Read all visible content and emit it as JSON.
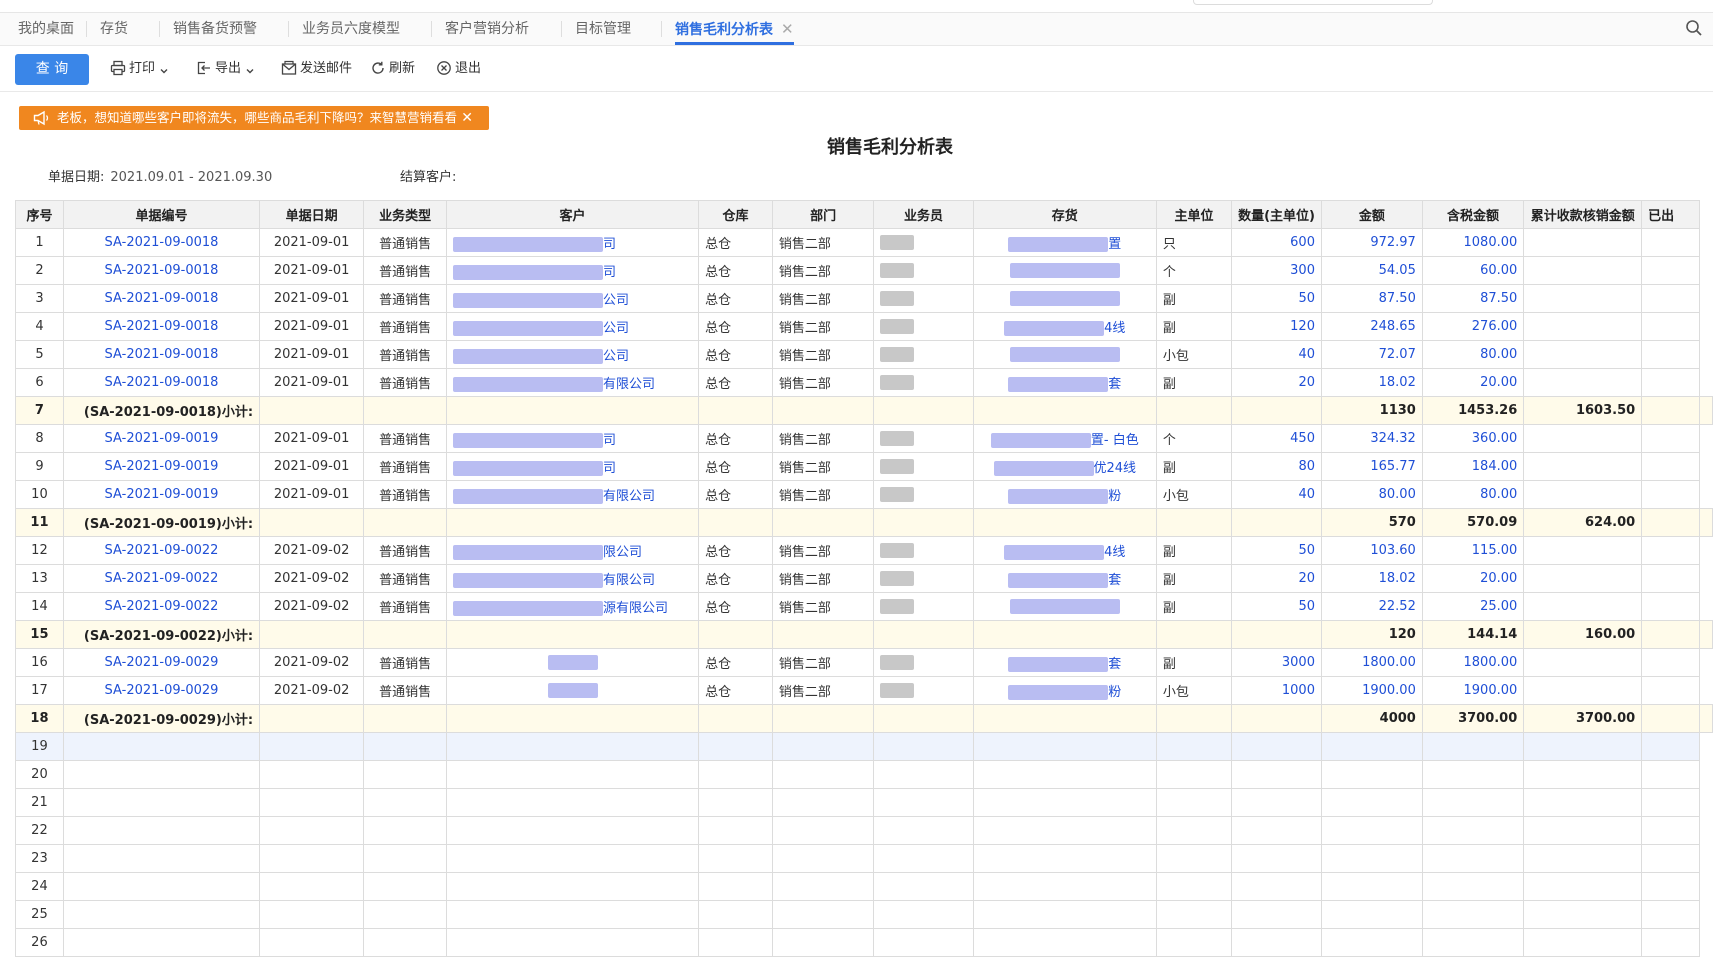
{
  "tabs": [
    {
      "label": "我的桌面",
      "active": false
    },
    {
      "label": "存货",
      "active": false
    },
    {
      "label": "销售备货预警",
      "active": false
    },
    {
      "label": "业务员六度模型",
      "active": false
    },
    {
      "label": "客户营销分析",
      "active": false
    },
    {
      "label": "目标管理",
      "active": false
    },
    {
      "label": "销售毛利分析表",
      "active": true
    }
  ],
  "toolbar": {
    "query": "查 询",
    "print": "打印",
    "export": "导出",
    "send_mail": "发送邮件",
    "refresh": "刷新",
    "exit": "退出"
  },
  "banner": {
    "text": "老板，想知道哪些客户即将流失，哪些商品毛利下降吗？来智慧营销看看"
  },
  "report": {
    "title": "销售毛利分析表",
    "date_label": "单据日期:",
    "date_value": "2021.09.01 - 2021.09.30",
    "customer_label": "结算客户:"
  },
  "columns": [
    "序号",
    "单据编号",
    "单据日期",
    "业务类型",
    "客户",
    "仓库",
    "部门",
    "业务员",
    "存货",
    "主单位",
    "数量(主单位)",
    "金额",
    "含税金额",
    "累计收款核销金额",
    "已出"
  ],
  "rows": [
    {
      "no": "1",
      "doc": "SA-2021-09-0018",
      "date": "2021-09-01",
      "type": "普通销售",
      "cust_tail": "司",
      "wh": "总仓",
      "dept": "销售二部",
      "inv_tail": "置",
      "unit": "只",
      "qty": "600",
      "amt": "972.97",
      "tax": "1080.00"
    },
    {
      "no": "2",
      "doc": "SA-2021-09-0018",
      "date": "2021-09-01",
      "type": "普通销售",
      "cust_tail": "司",
      "wh": "总仓",
      "dept": "销售二部",
      "inv_tail": "",
      "unit": "个",
      "qty": "300",
      "amt": "54.05",
      "tax": "60.00"
    },
    {
      "no": "3",
      "doc": "SA-2021-09-0018",
      "date": "2021-09-01",
      "type": "普通销售",
      "cust_tail": "公司",
      "wh": "总仓",
      "dept": "销售二部",
      "inv_tail": "",
      "unit": "副",
      "qty": "50",
      "amt": "87.50",
      "tax": "87.50"
    },
    {
      "no": "4",
      "doc": "SA-2021-09-0018",
      "date": "2021-09-01",
      "type": "普通销售",
      "cust_tail": "公司",
      "wh": "总仓",
      "dept": "销售二部",
      "inv_tail": "4线",
      "unit": "副",
      "qty": "120",
      "amt": "248.65",
      "tax": "276.00"
    },
    {
      "no": "5",
      "doc": "SA-2021-09-0018",
      "date": "2021-09-01",
      "type": "普通销售",
      "cust_tail": "公司",
      "wh": "总仓",
      "dept": "销售二部",
      "inv_tail": "",
      "unit": "小包",
      "qty": "40",
      "amt": "72.07",
      "tax": "80.00"
    },
    {
      "no": "6",
      "doc": "SA-2021-09-0018",
      "date": "2021-09-01",
      "type": "普通销售",
      "cust_tail": "有限公司",
      "wh": "总仓",
      "dept": "销售二部",
      "inv_tail": "套",
      "unit": "副",
      "qty": "20",
      "amt": "18.02",
      "tax": "20.00"
    },
    {
      "no": "7",
      "subtotal": "(SA-2021-09-0018)小计:",
      "qty": "1130",
      "amt": "1453.26",
      "tax": "1603.50"
    },
    {
      "no": "8",
      "doc": "SA-2021-09-0019",
      "date": "2021-09-01",
      "type": "普通销售",
      "cust_tail": "司",
      "wh": "总仓",
      "dept": "销售二部",
      "inv_tail": "置- 白色",
      "unit": "个",
      "qty": "450",
      "amt": "324.32",
      "tax": "360.00"
    },
    {
      "no": "9",
      "doc": "SA-2021-09-0019",
      "date": "2021-09-01",
      "type": "普通销售",
      "cust_tail": "司",
      "wh": "总仓",
      "dept": "销售二部",
      "inv_tail": "优24线",
      "unit": "副",
      "qty": "80",
      "amt": "165.77",
      "tax": "184.00"
    },
    {
      "no": "10",
      "doc": "SA-2021-09-0019",
      "date": "2021-09-01",
      "type": "普通销售",
      "cust_tail": "有限公司",
      "wh": "总仓",
      "dept": "销售二部",
      "inv_tail": "粉",
      "unit": "小包",
      "qty": "40",
      "amt": "80.00",
      "tax": "80.00"
    },
    {
      "no": "11",
      "subtotal": "(SA-2021-09-0019)小计:",
      "qty": "570",
      "amt": "570.09",
      "tax": "624.00"
    },
    {
      "no": "12",
      "doc": "SA-2021-09-0022",
      "date": "2021-09-02",
      "type": "普通销售",
      "cust_tail": "限公司",
      "wh": "总仓",
      "dept": "销售二部",
      "inv_tail": "4线",
      "unit": "副",
      "qty": "50",
      "amt": "103.60",
      "tax": "115.00"
    },
    {
      "no": "13",
      "doc": "SA-2021-09-0022",
      "date": "2021-09-02",
      "type": "普通销售",
      "cust_tail": "有限公司",
      "wh": "总仓",
      "dept": "销售二部",
      "inv_tail": "套",
      "unit": "副",
      "qty": "20",
      "amt": "18.02",
      "tax": "20.00"
    },
    {
      "no": "14",
      "doc": "SA-2021-09-0022",
      "date": "2021-09-02",
      "type": "普通销售",
      "cust_tail": "源有限公司",
      "wh": "总仓",
      "dept": "销售二部",
      "inv_tail": "",
      "unit": "副",
      "qty": "50",
      "amt": "22.52",
      "tax": "25.00"
    },
    {
      "no": "15",
      "subtotal": "(SA-2021-09-0022)小计:",
      "qty": "120",
      "amt": "144.14",
      "tax": "160.00"
    },
    {
      "no": "16",
      "doc": "SA-2021-09-0029",
      "date": "2021-09-02",
      "type": "普通销售",
      "cust_tail": "",
      "wh": "总仓",
      "dept": "销售二部",
      "inv_tail": "套",
      "unit": "副",
      "qty": "3000",
      "amt": "1800.00",
      "tax": "1800.00"
    },
    {
      "no": "17",
      "doc": "SA-2021-09-0029",
      "date": "2021-09-02",
      "type": "普通销售",
      "cust_tail": "",
      "wh": "总仓",
      "dept": "销售二部",
      "inv_tail": "粉",
      "unit": "小包",
      "qty": "1000",
      "amt": "1900.00",
      "tax": "1900.00"
    },
    {
      "no": "18",
      "subtotal": "(SA-2021-09-0029)小计:",
      "qty": "4000",
      "amt": "3700.00",
      "tax": "3700.00"
    },
    {
      "no": "19",
      "empty": true,
      "selected": true
    },
    {
      "no": "20",
      "empty": true
    },
    {
      "no": "21",
      "empty": true
    },
    {
      "no": "22",
      "empty": true
    },
    {
      "no": "23",
      "empty": true
    },
    {
      "no": "24",
      "empty": true
    },
    {
      "no": "25",
      "empty": true
    },
    {
      "no": "26",
      "empty": true
    }
  ],
  "colors": {
    "accent": "#3a86e8",
    "link": "#1f4fd6",
    "banner": "#f0871f",
    "subtotal_bg": "#fffbea"
  }
}
